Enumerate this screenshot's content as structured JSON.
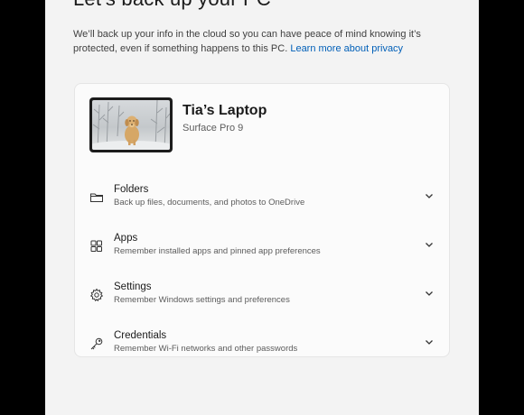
{
  "page": {
    "title": "Let’s back up your PC",
    "intro_text": "We’ll back up your info in the cloud so you can have peace of mind knowing it’s protected, even if something happens to this PC.",
    "privacy_link": "Learn more about privacy"
  },
  "device": {
    "name": "Tia’s Laptop",
    "model": "Surface Pro 9",
    "thumbnail": "dog-in-snow-image"
  },
  "backup_items": [
    {
      "title": "Folders",
      "subtitle": "Back up files, documents, and photos to OneDrive",
      "icon": "folder-icon"
    },
    {
      "title": "Apps",
      "subtitle": "Remember installed apps and pinned app preferences",
      "icon": "apps-icon"
    },
    {
      "title": "Settings",
      "subtitle": "Remember Windows settings and preferences",
      "icon": "gear-icon"
    },
    {
      "title": "Credentials",
      "subtitle": "Remember Wi-Fi networks and other passwords",
      "icon": "key-icon"
    }
  ],
  "colors": {
    "accent": "#005fb8",
    "window_bg": "#f3f3f3",
    "card_bg": "#fbfbfb"
  }
}
